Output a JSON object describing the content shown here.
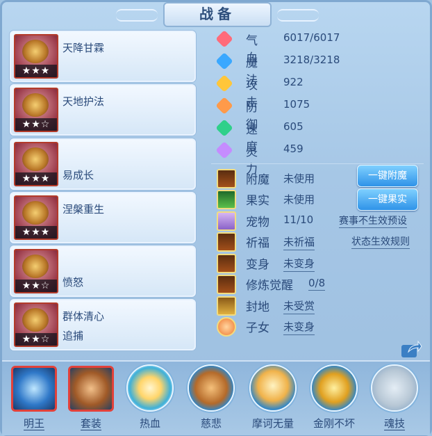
{
  "title": "战备",
  "skills": [
    {
      "name": "天降甘霖",
      "stars": "★★★",
      "sub": ""
    },
    {
      "name": "天地护法",
      "stars": "★★☆",
      "sub": ""
    },
    {
      "name": "易成长",
      "stars": "★★★",
      "sub": ""
    },
    {
      "name": "涅槃重生",
      "stars": "★★★",
      "sub": ""
    },
    {
      "name": "愤怒",
      "stars": "★★☆",
      "sub": ""
    },
    {
      "name": "群体清心",
      "stars": "★★☆",
      "sub": "追捕"
    }
  ],
  "stats": [
    {
      "icon": "heart-icon",
      "color": "#ff6b7a",
      "label": "气血",
      "value": "6017/6017"
    },
    {
      "icon": "mana-icon",
      "color": "#3aa8ff",
      "label": "魔法",
      "value": "3218/3218"
    },
    {
      "icon": "sword-icon",
      "color": "#ffc63a",
      "label": "攻击",
      "value": "922"
    },
    {
      "icon": "shield-icon",
      "color": "#ff9a4a",
      "label": "防御",
      "value": "1075"
    },
    {
      "icon": "speed-icon",
      "color": "#2fd08a",
      "label": "速度",
      "value": "605"
    },
    {
      "icon": "spirit-icon",
      "color": "#c58cff",
      "label": "灵力",
      "value": "459"
    }
  ],
  "misc": [
    {
      "icon": "enchant-icon",
      "label": "附魔",
      "value": "未使用"
    },
    {
      "icon": "fruit-icon",
      "label": "果实",
      "value": "未使用"
    },
    {
      "icon": "pet-icon",
      "label": "宠物",
      "value": "11/10"
    },
    {
      "icon": "pray-icon",
      "label": "祈福",
      "value": "未祈福"
    },
    {
      "icon": "transform-icon",
      "label": "变身",
      "value": "未变身"
    },
    {
      "icon": "cultivate-icon",
      "label": "修炼觉醒",
      "value": "0/8"
    },
    {
      "icon": "fief-icon",
      "label": "封地",
      "value": "未受赏"
    },
    {
      "icon": "child-icon",
      "label": "子女",
      "value": "未变身"
    }
  ],
  "buttons": {
    "enchant": "一键附魔",
    "fruit": "一键果实"
  },
  "links": {
    "pet_preset": "赛事不生效预设",
    "status_rules": "状态生效规则"
  },
  "bottom": [
    {
      "icon": "ming-wang-icon",
      "label": "明王"
    },
    {
      "icon": "equipment-set-icon",
      "label": "套装"
    },
    {
      "icon": "passion-icon",
      "label": "热血"
    },
    {
      "icon": "mercy-icon",
      "label": "慈悲"
    },
    {
      "icon": "mohe-icon",
      "label": "摩诃无量"
    },
    {
      "icon": "vajra-icon",
      "label": "金刚不坏"
    },
    {
      "icon": "soul-skill-icon",
      "label": "魂技"
    }
  ]
}
